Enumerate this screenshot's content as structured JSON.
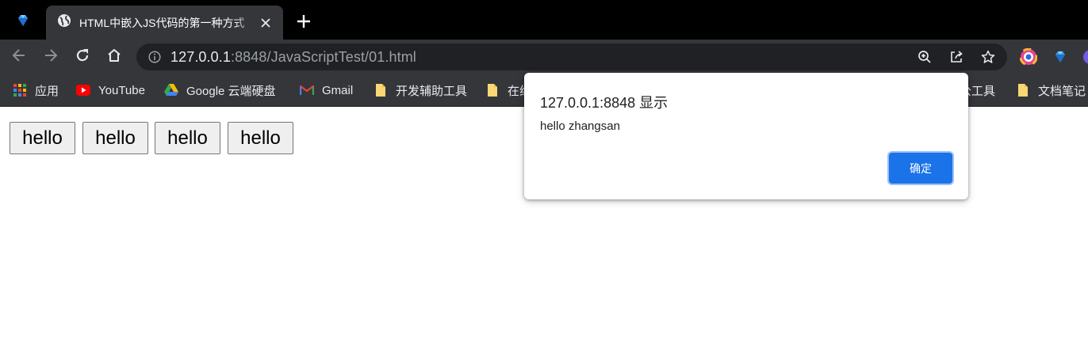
{
  "browser": {
    "tab": {
      "title": "HTML中嵌入JS代码的第一种方式"
    },
    "address": {
      "host": "127.0.0.1",
      "rest": ":8848/JavaScriptTest/01.html"
    },
    "bookmarks": [
      {
        "label": "应用",
        "icon": "apps-grid-icon"
      },
      {
        "label": "YouTube",
        "icon": "youtube-icon"
      },
      {
        "label": "Google 云端硬盘",
        "icon": "google-drive-icon"
      },
      {
        "label": "Gmail",
        "icon": "gmail-icon"
      },
      {
        "label": "开发辅助工具",
        "icon": "folder-icon"
      },
      {
        "label": "在线",
        "icon": "folder-icon"
      },
      {
        "label": "公工具",
        "icon": "folder-icon"
      },
      {
        "label": "文档笔记",
        "icon": "folder-icon"
      }
    ]
  },
  "page": {
    "buttons": [
      {
        "label": "hello"
      },
      {
        "label": "hello"
      },
      {
        "label": "hello"
      },
      {
        "label": "hello"
      }
    ]
  },
  "dialog": {
    "title": "127.0.0.1:8848 显示",
    "message": "hello zhangsan",
    "ok_label": "确定"
  },
  "colors": {
    "tabstrip": "#000000",
    "toolbar": "#35363a",
    "omnibox": "#202124",
    "accent": "#1a73e8"
  }
}
